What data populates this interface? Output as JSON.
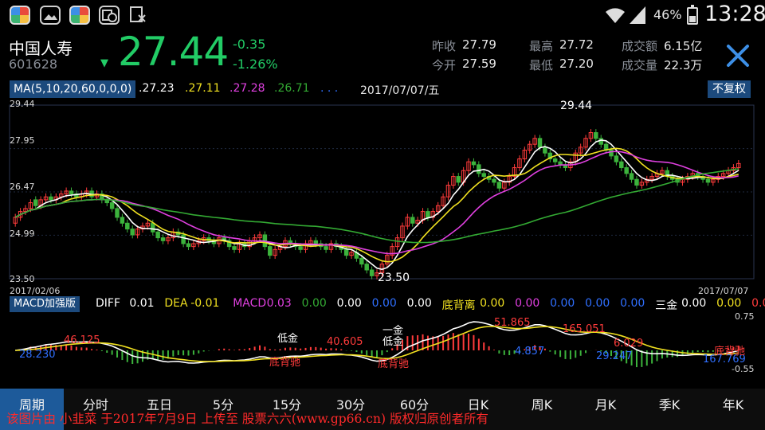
{
  "status_bar": {
    "battery": "46%",
    "battery_level": 0.46,
    "time": "13:28",
    "app_icons": [
      "colorful-app-icon",
      "gallery-icon",
      "colorful-app-icon",
      "calendar-clock-icon",
      "file-x-icon"
    ]
  },
  "quote": {
    "name": "中国人寿",
    "code": "601628",
    "price": "27.44",
    "change": "-0.35",
    "change_pct": "-1.26%",
    "stats": [
      {
        "label": "昨收",
        "value": "27.79"
      },
      {
        "label": "今开",
        "value": "27.59"
      },
      {
        "label": "最高",
        "value": "27.72"
      },
      {
        "label": "最低",
        "value": "27.20"
      },
      {
        "label": "成交额",
        "value": "6.15亿"
      },
      {
        "label": "成交量",
        "value": "22.3万"
      }
    ]
  },
  "ma": {
    "label": "MA(5,10,20,60,0,0,0)",
    "values": [
      ".27.23",
      ".27.11",
      ".27.28",
      ".26.71",
      ". . ."
    ],
    "date": "2017/07/07/五",
    "adjust_button": "不复权"
  },
  "main_axis": {
    "y_ticks": [
      "29.44",
      "27.95",
      "26.47",
      "24.99",
      "23.50"
    ],
    "x_start": "2017/02/06",
    "x_end": "2017/07/07",
    "high_label": "29.44",
    "low_label": "23.50"
  },
  "macd": {
    "tag": "MACD加强版",
    "fields": [
      {
        "label": "DIFF",
        "value": "0.01"
      },
      {
        "label": "DEA",
        "value": "-0.01"
      },
      {
        "label": "MACD",
        "value": "0.03"
      },
      {
        "label": "",
        "value": "0.00"
      },
      {
        "label": "",
        "value": "0.00"
      },
      {
        "label": "",
        "value": "0.00"
      },
      {
        "label": "",
        "value": "0.00"
      },
      {
        "label": "底背离",
        "value": "0.00"
      },
      {
        "label": "",
        "value": "0.00"
      },
      {
        "label": "",
        "value": "0.00"
      },
      {
        "label": "",
        "value": "0.00"
      },
      {
        "label": "",
        "value": "0.00"
      },
      {
        "label": "三金",
        "value": "0.00"
      },
      {
        "label": "",
        "value": "0.00"
      },
      {
        "label": "",
        "value": "0.0"
      }
    ],
    "y_top": "0.75",
    "y_bottom": "-0.55",
    "annotations": [
      {
        "text": "28.230",
        "color": "#2f6fff"
      },
      {
        "text": "46.125",
        "color": "#ff3b3b"
      },
      {
        "text": "低金",
        "color": "#ffffff"
      },
      {
        "text": "40.605",
        "color": "#ff3b3b"
      },
      {
        "text": "底背驰",
        "color": "#ff3b3b"
      },
      {
        "text": "一金",
        "color": "#ffffff"
      },
      {
        "text": "低金",
        "color": "#ffffff"
      },
      {
        "text": "底背驰",
        "color": "#ff3b3b"
      },
      {
        "text": "4.857",
        "color": "#2f6fff"
      },
      {
        "text": "51.865",
        "color": "#ff3b3b"
      },
      {
        "text": "165.051",
        "color": "#ff3b3b"
      },
      {
        "text": "6.029",
        "color": "#ff3b3b"
      },
      {
        "text": "29.247",
        "color": "#2f6fff"
      },
      {
        "text": "167.769",
        "color": "#2f6fff"
      },
      {
        "text": "底背驰",
        "color": "#ff3b3b"
      }
    ]
  },
  "tabs": [
    "周期",
    "分时",
    "五日",
    "5分",
    "15分",
    "30分",
    "60分",
    "日K",
    "周K",
    "月K",
    "季K",
    "年K"
  ],
  "watermark": "该图片由 小韭菜 于2017年7月9日 上传至 股票六六(www.gp66.cn) 版权归原创者所有",
  "colors": {
    "up": "#ff3b3b",
    "down": "#3cb33c",
    "ma5": "#ffffff",
    "ma10": "#f0e020",
    "ma20": "#e040e0",
    "ma60": "#33aa33",
    "price": "#22cc66",
    "panel_tag": "#1c4a7d",
    "active_tab": "#1d5a9a"
  },
  "chart_data": {
    "type": "candlestick",
    "title": "",
    "x_range": [
      "2017/02/06",
      "2017/07/07"
    ],
    "ylim": [
      23.5,
      29.44
    ],
    "series_note": "",
    "close": [
      25.6,
      25.8,
      25.9,
      26.1,
      26.0,
      26.2,
      26.3,
      26.2,
      26.3,
      26.4,
      26.5,
      26.4,
      26.3,
      26.4,
      26.5,
      26.3,
      26.4,
      26.2,
      26.1,
      25.9,
      25.6,
      25.4,
      25.2,
      25.0,
      25.2,
      25.3,
      25.4,
      25.1,
      24.9,
      24.8,
      24.9,
      25.1,
      25.0,
      24.7,
      24.6,
      24.7,
      24.8,
      24.9,
      24.8,
      24.7,
      24.9,
      24.8,
      24.6,
      24.5,
      24.7,
      24.6,
      24.8,
      24.9,
      25.0,
      24.6,
      24.3,
      24.5,
      24.6,
      24.8,
      24.7,
      24.6,
      24.5,
      24.7,
      24.8,
      24.7,
      24.6,
      24.5,
      24.7,
      24.6,
      24.5,
      24.3,
      24.4,
      24.2,
      24.0,
      23.8,
      23.6,
      23.7,
      24.0,
      24.3,
      24.6,
      24.9,
      25.3,
      25.6,
      25.4,
      25.5,
      25.8,
      25.6,
      25.8,
      26.0,
      26.3,
      26.7,
      27.0,
      26.8,
      27.2,
      27.5,
      27.4,
      27.1,
      27.0,
      26.9,
      26.8,
      26.6,
      26.8,
      27.0,
      27.3,
      27.6,
      27.9,
      28.1,
      28.3,
      28.0,
      27.8,
      27.6,
      27.5,
      27.4,
      27.3,
      27.5,
      27.8,
      28.0,
      28.3,
      28.5,
      28.3,
      28.1,
      27.9,
      27.7,
      27.5,
      27.3,
      27.1,
      26.9,
      26.7,
      26.8,
      26.9,
      27.0,
      27.1,
      27.2,
      27.0,
      26.9,
      26.8,
      26.9,
      27.0,
      27.1,
      27.0,
      26.9,
      26.8,
      26.9,
      27.0,
      27.1,
      27.2,
      27.3,
      27.44
    ],
    "open": [
      25.4,
      25.6,
      25.8,
      25.9,
      26.2,
      26.0,
      26.2,
      26.3,
      26.2,
      26.3,
      26.4,
      26.5,
      26.4,
      26.3,
      26.4,
      26.5,
      26.3,
      26.4,
      26.2,
      26.1,
      25.9,
      25.6,
      25.4,
      25.2,
      25.0,
      25.2,
      25.3,
      25.4,
      25.1,
      24.9,
      24.8,
      24.9,
      25.1,
      25.0,
      24.7,
      24.6,
      24.7,
      24.8,
      24.9,
      24.8,
      24.7,
      24.9,
      24.8,
      24.6,
      24.5,
      24.7,
      24.6,
      24.8,
      24.9,
      25.0,
      24.6,
      24.3,
      24.5,
      24.6,
      24.8,
      24.7,
      24.6,
      24.5,
      24.7,
      24.8,
      24.7,
      24.6,
      24.5,
      24.7,
      24.6,
      24.5,
      24.3,
      24.4,
      24.2,
      24.0,
      23.8,
      23.6,
      23.7,
      24.0,
      24.3,
      24.6,
      24.9,
      25.3,
      25.6,
      25.4,
      25.5,
      25.8,
      25.6,
      25.8,
      26.0,
      26.3,
      26.7,
      27.0,
      26.8,
      27.2,
      27.5,
      27.4,
      27.1,
      27.0,
      26.9,
      26.8,
      26.6,
      26.8,
      27.0,
      27.3,
      27.6,
      27.9,
      28.1,
      28.3,
      28.0,
      27.8,
      27.6,
      27.5,
      27.4,
      27.3,
      27.5,
      27.8,
      28.0,
      28.3,
      28.5,
      28.3,
      28.1,
      27.9,
      27.7,
      27.5,
      27.3,
      27.1,
      26.9,
      26.7,
      26.8,
      26.9,
      27.0,
      27.1,
      27.2,
      27.0,
      26.9,
      26.8,
      26.9,
      27.0,
      27.1,
      27.0,
      26.9,
      26.8,
      26.9,
      27.0,
      27.1,
      27.2,
      27.3,
      27.59
    ]
  }
}
